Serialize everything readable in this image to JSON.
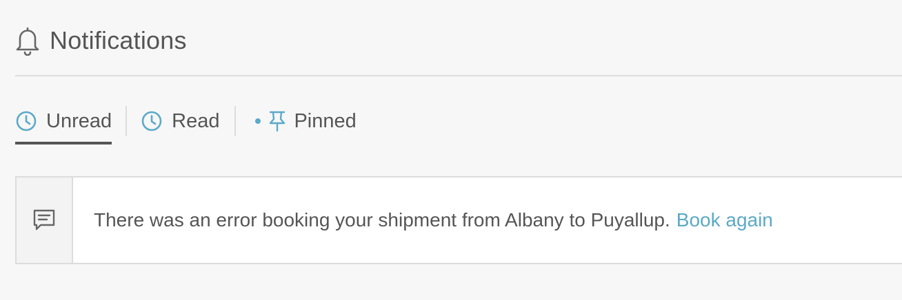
{
  "header": {
    "icon": "bell-icon",
    "title": "Notifications"
  },
  "tabs": [
    {
      "label": "Unread",
      "icon": "clock-icon",
      "active": true
    },
    {
      "label": "Read",
      "icon": "clock-icon",
      "active": false
    },
    {
      "label": "Pinned",
      "icon": "pin-icon",
      "active": false,
      "indicator": "dot"
    }
  ],
  "notifications": [
    {
      "icon": "message-icon",
      "text": "There was an error booking your shipment from Albany to Puyallup.",
      "action_label": "Book again"
    }
  ],
  "colors": {
    "accent": "#5ba9c9",
    "text": "#555555",
    "background": "#f7f7f7",
    "border": "#dcdcdc"
  }
}
